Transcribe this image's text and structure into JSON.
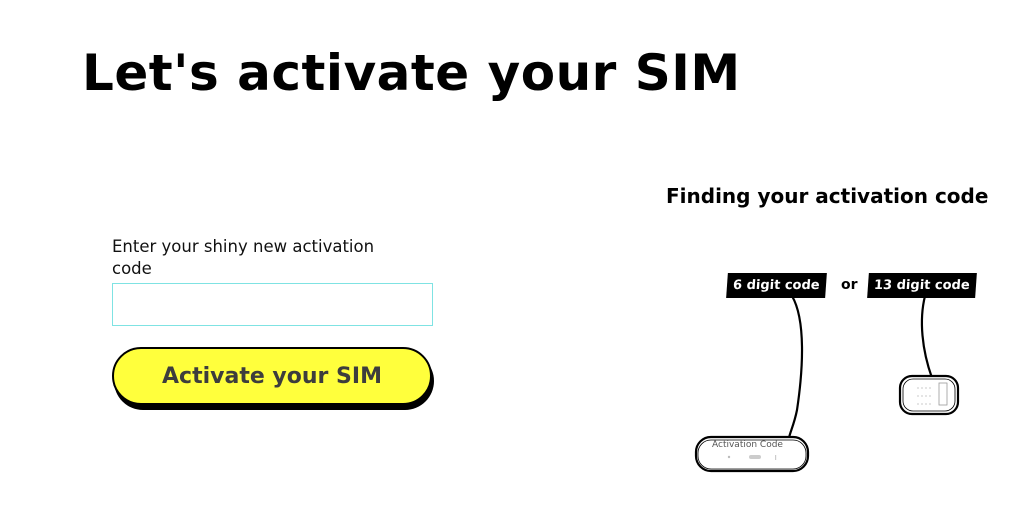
{
  "page": {
    "title": "Let's activate your SIM"
  },
  "form": {
    "label": "Enter your shiny new activation code",
    "input_value": "",
    "input_placeholder": "",
    "submit_label": "Activate your SIM",
    "accent_color": "#ffff3c",
    "input_border_color": "#7fe3e3"
  },
  "help": {
    "heading": "Finding your activation code",
    "tag_6": "6 digit code",
    "separator": "or",
    "tag_13": "13  digit code",
    "card_label": "Activation Code"
  }
}
